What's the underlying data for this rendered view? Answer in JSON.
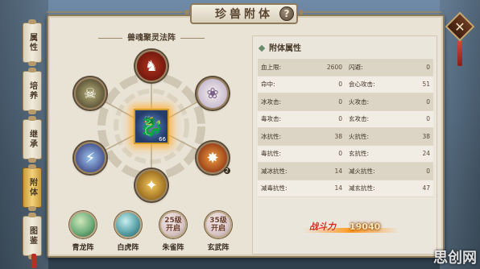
{
  "window": {
    "title": "珍兽附体",
    "help_label": "?",
    "close_label": "✕"
  },
  "side_tabs": [
    {
      "label": "属性",
      "active": false
    },
    {
      "label": "培养",
      "active": false
    },
    {
      "label": "继承",
      "active": false
    },
    {
      "label": "附体",
      "active": true
    },
    {
      "label": "图鉴",
      "active": false
    }
  ],
  "formation": {
    "title": "兽魂聚灵法阵",
    "center_level": "66",
    "nodes": [
      {
        "icon": "red-beast-icon",
        "level": ""
      },
      {
        "icon": "skull-icon",
        "level": ""
      },
      {
        "icon": "white-cat-icon",
        "level": ""
      },
      {
        "icon": "claw-icon",
        "level": ""
      },
      {
        "icon": "fire-wing-icon",
        "level": "2"
      },
      {
        "icon": "golden-horn-icon",
        "level": ""
      }
    ]
  },
  "formation_buttons": [
    {
      "name": "青龙阵",
      "locked": false,
      "orb": "",
      "color": "#6fae7c"
    },
    {
      "name": "白虎阵",
      "locked": false,
      "orb": "",
      "color": "#5aa2a8"
    },
    {
      "name": "朱雀阵",
      "locked": true,
      "orb": "25级开启",
      "color": "#d8c4c4"
    },
    {
      "name": "玄武阵",
      "locked": true,
      "orb": "35级开启",
      "color": "#d8c4c4"
    }
  ],
  "attributes": {
    "title": "附体属性",
    "rows": [
      [
        {
          "label": "血上限:",
          "value": "2600"
        },
        {
          "label": "闪避:",
          "value": "0"
        }
      ],
      [
        {
          "label": "命中:",
          "value": "0"
        },
        {
          "label": "会心攻击:",
          "value": "51"
        }
      ],
      [
        {
          "label": "冰攻击:",
          "value": "0"
        },
        {
          "label": "火攻击:",
          "value": "0"
        }
      ],
      [
        {
          "label": "毒攻击:",
          "value": "0"
        },
        {
          "label": "玄攻击:",
          "value": "0"
        }
      ],
      [
        {
          "label": "冰抗性:",
          "value": "38"
        },
        {
          "label": "火抗性:",
          "value": "38"
        }
      ],
      [
        {
          "label": "毒抗性:",
          "value": "0"
        },
        {
          "label": "玄抗性:",
          "value": "24"
        }
      ],
      [
        {
          "label": "减冰抗性:",
          "value": "14"
        },
        {
          "label": "减火抗性:",
          "value": "0"
        }
      ],
      [
        {
          "label": "减毒抗性:",
          "value": "14"
        },
        {
          "label": "减玄抗性:",
          "value": "47"
        }
      ]
    ]
  },
  "power": {
    "label": "战斗力",
    "value": "19040"
  },
  "watermark": "思创网",
  "colors": {
    "accent_gold": "#d19a2c",
    "power_red": "#d8281b"
  }
}
